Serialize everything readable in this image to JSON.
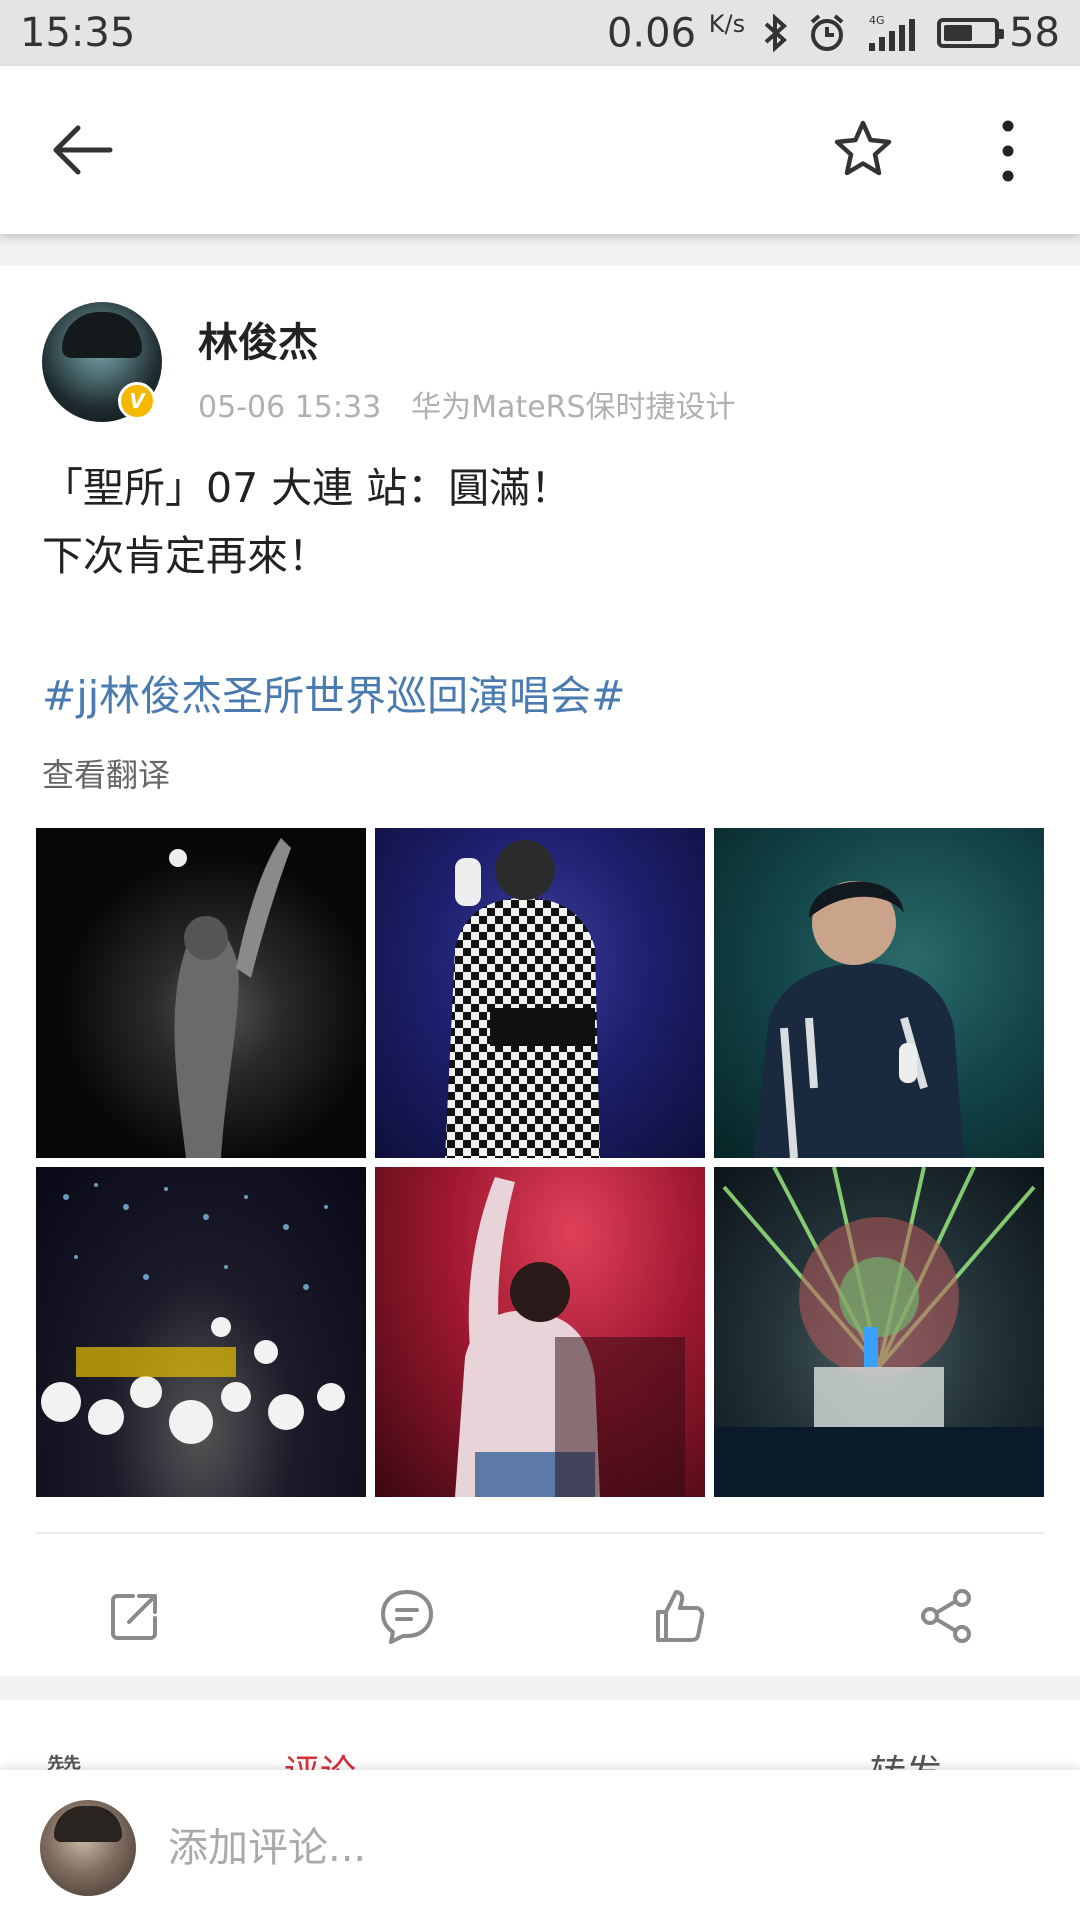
{
  "status_bar": {
    "time": "15:35",
    "speed": "0.06",
    "speed_unit": "K/s",
    "network": "4G",
    "battery": "58",
    "battery_level": 0.58
  },
  "toolbar": {
    "back_icon": "arrow-left",
    "favorite_icon": "star-outline",
    "more_icon": "vertical-dots"
  },
  "post": {
    "author": "林俊杰",
    "verified_badge": "V",
    "time": "05-06 15:33",
    "source": "华为MateRS保时捷设计",
    "text_line1": "「聖所」07 大連 站：圓滿！",
    "text_line2": "下次肯定再來！",
    "hashtag": "#jj林俊杰圣所世界巡回演唱会#",
    "translate_link": "查看翻译",
    "photos": 6
  },
  "actions": {
    "repost_icon": "external-share",
    "comment_icon": "comment-bubble",
    "like_icon": "thumbs-up",
    "share_icon": "share-nodes"
  },
  "comment_bar": {
    "placeholder": "添加评论..."
  },
  "colors": {
    "hashtag": "#4a7bb0",
    "comment_tab": "#d6323c",
    "verified": "#f5b800"
  }
}
